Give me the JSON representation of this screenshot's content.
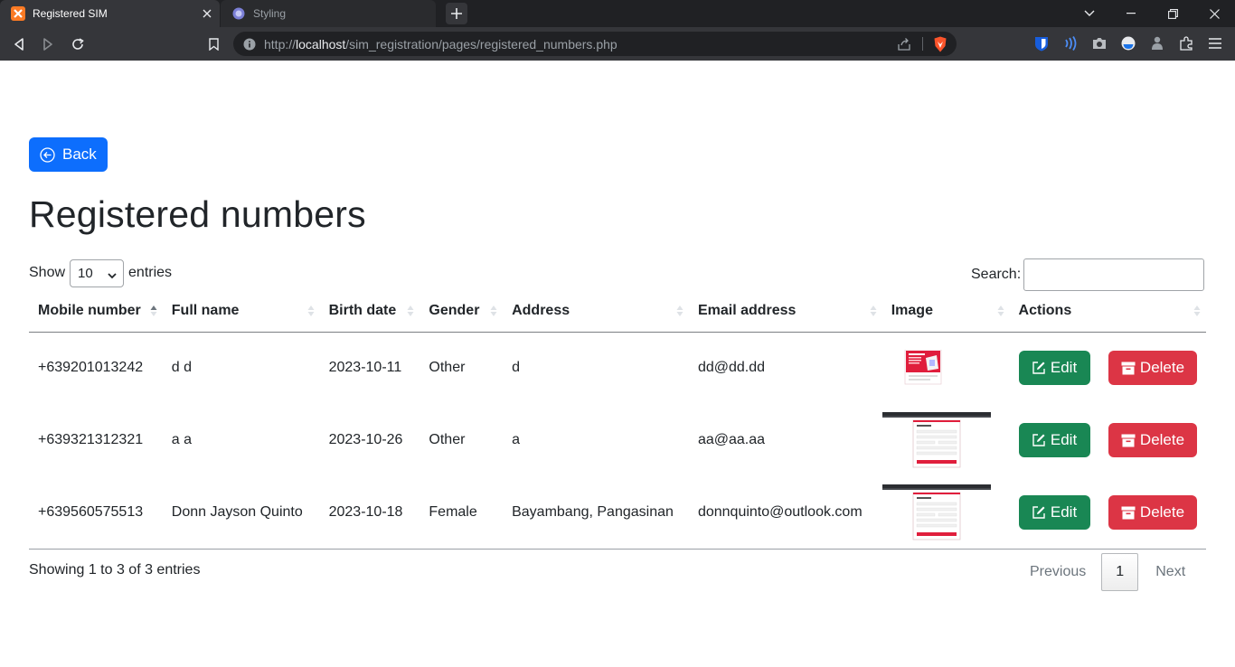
{
  "browser": {
    "tabs": [
      {
        "title": "Registered SIM",
        "active": true
      },
      {
        "title": "Styling",
        "active": false
      }
    ],
    "url_prefix": "http://",
    "url_host": "localhost",
    "url_path": "/sim_registration/pages/registered_numbers.php"
  },
  "page": {
    "back_label": "Back",
    "title": "Registered numbers",
    "length_prefix": "Show",
    "length_value": "10",
    "length_suffix": "entries",
    "search_label": "Search:",
    "search_value": ""
  },
  "table": {
    "columns": [
      "Mobile number",
      "Full name",
      "Birth date",
      "Gender",
      "Address",
      "Email address",
      "Image",
      "Actions"
    ],
    "sorted_column": "Mobile number",
    "rows": [
      {
        "mobile": "+639201013242",
        "name": "d d",
        "birth": "2023-10-11",
        "gender": "Other",
        "address": "d",
        "email": "dd@dd.dd",
        "image": "thumbnail-promo"
      },
      {
        "mobile": "+639321312321",
        "name": "a a",
        "birth": "2023-10-26",
        "gender": "Other",
        "address": "a",
        "email": "aa@aa.aa",
        "image": "thumbnail-form-screenshot"
      },
      {
        "mobile": "+639560575513",
        "name": "Donn Jayson Quinto",
        "birth": "2023-10-18",
        "gender": "Female",
        "address": "Bayambang, Pangasinan",
        "email": "donnquinto@outlook.com",
        "image": "thumbnail-form-screenshot"
      }
    ],
    "edit_label": "Edit",
    "delete_label": "Delete"
  },
  "footer": {
    "info": "Showing 1 to 3 of 3 entries",
    "previous": "Previous",
    "page": "1",
    "next": "Next"
  },
  "colors": {
    "primary": "#0d6efd",
    "success": "#198754",
    "danger": "#dc3545"
  }
}
